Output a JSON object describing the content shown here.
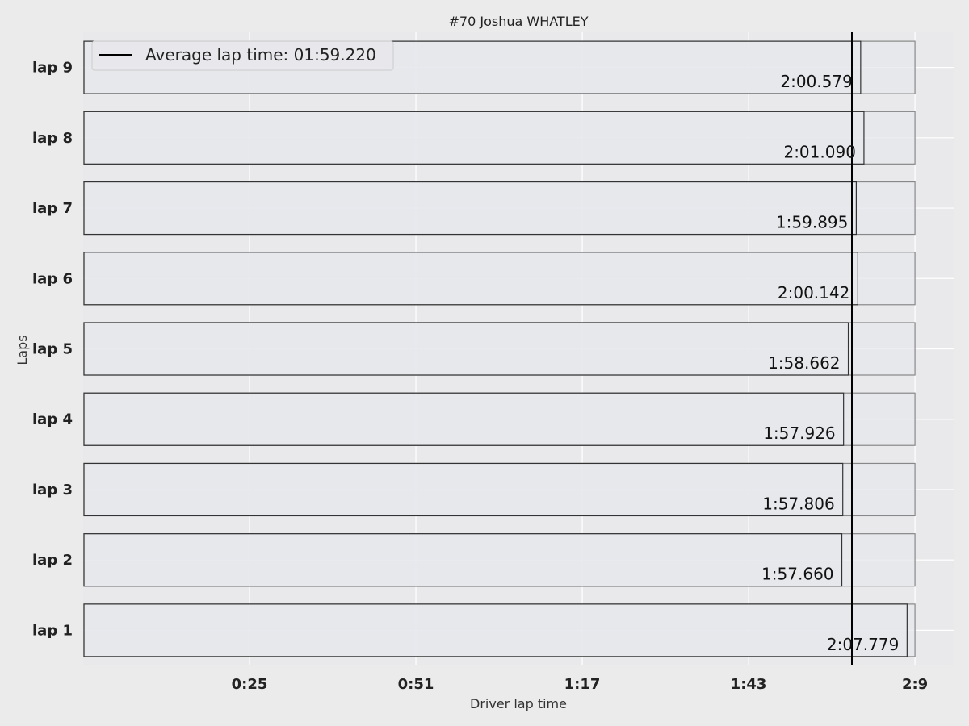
{
  "chart_data": {
    "type": "bar",
    "orientation": "horizontal",
    "title": "#70  Joshua WHATLEY",
    "xlabel": "Driver lap time",
    "ylabel": "Laps",
    "categories": [
      "lap 1",
      "lap 2",
      "lap 3",
      "lap 4",
      "lap 5",
      "lap 6",
      "lap 7",
      "lap 8",
      "lap 9"
    ],
    "values": [
      127.779,
      117.66,
      117.806,
      117.926,
      118.662,
      120.142,
      119.895,
      121.09,
      120.579
    ],
    "data_labels": [
      "2:07.779",
      "1:57.660",
      "1:57.806",
      "1:57.926",
      "1:58.662",
      "2:00.142",
      "1:59.895",
      "2:01.090",
      "2:00.579"
    ],
    "max_bar_value": 129,
    "average": {
      "value": 119.22,
      "label": "Average lap time: 01:59.220"
    },
    "xlim": [
      0,
      135
    ],
    "xticks": [
      {
        "value": 25.8,
        "label": "0:25"
      },
      {
        "value": 51.6,
        "label": "0:51"
      },
      {
        "value": 77.4,
        "label": "1:17"
      },
      {
        "value": 103.2,
        "label": "1:43"
      },
      {
        "value": 129,
        "label": "2:9"
      }
    ],
    "grid": true,
    "legend_position": "top-left",
    "colors": {
      "background": "#ebebeb",
      "plot_background": "#e9e9ec",
      "grid": "#ffffff",
      "bar_fill": "#e6e7ec",
      "bar_edge": "#333333",
      "max_bar_edge": "#888888",
      "average_line": "#000000"
    }
  }
}
